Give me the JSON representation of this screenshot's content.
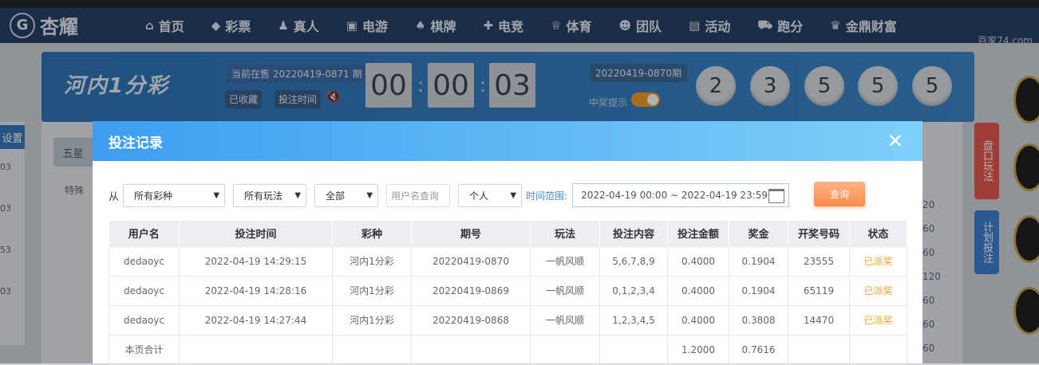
{
  "nav": {
    "logo": "杏耀",
    "items": [
      {
        "icon": "home-icon",
        "glyph": "⌂",
        "label": "首页"
      },
      {
        "icon": "ticket-icon",
        "glyph": "◆",
        "label": "彩票"
      },
      {
        "icon": "person-icon",
        "glyph": "♟",
        "label": "真人"
      },
      {
        "icon": "slot-icon",
        "glyph": "▣",
        "label": "电游"
      },
      {
        "icon": "cards-icon",
        "glyph": "♠",
        "label": "棋牌"
      },
      {
        "icon": "gamepad-icon",
        "glyph": "✚",
        "label": "电竞"
      },
      {
        "icon": "trophy-icon",
        "glyph": "♕",
        "label": "体育"
      },
      {
        "icon": "team-icon",
        "glyph": "☻",
        "label": "团队"
      },
      {
        "icon": "gift-icon",
        "glyph": "▤",
        "label": "活动"
      },
      {
        "icon": "car-icon",
        "glyph": "⛟",
        "label": "跑分"
      },
      {
        "icon": "crown-icon",
        "glyph": "♛",
        "label": "金鼎财富"
      }
    ],
    "watermark": "百家74.com"
  },
  "lottery": {
    "name": "河内1分彩",
    "on_sale": "当前在售 20220419-0871 期",
    "saved": "已收藏",
    "bet_time": "投注时间",
    "countdown": [
      "00",
      "00",
      "03"
    ],
    "prev_period": "20220419-0870期",
    "prize_hint": "中奖提示",
    "balls": [
      "2",
      "3",
      "5",
      "5",
      "5"
    ]
  },
  "background": {
    "settings": "设置",
    "left_values": [
      "03",
      "03",
      "53",
      "03"
    ],
    "five_star": "五星",
    "special": "特殊",
    "right_tabs": [
      "盘口玩法",
      "计划投注"
    ],
    "right_values": [
      "20",
      "60",
      "60",
      "120",
      "60",
      "60",
      "60",
      "60"
    ]
  },
  "modal": {
    "title": "投注记录",
    "close": "✕",
    "from_label": "从",
    "lottery_select": "所有彩种",
    "play_select": "所有玩法",
    "all_select": "全部",
    "username_placeholder": "用户名查询",
    "scope_select": "个人",
    "time_label": "时间范围:",
    "date_range": "2022-04-19 00:00 ~ 2022-04-19 23:59",
    "query": "查询",
    "columns": [
      "用户名",
      "投注时间",
      "彩种",
      "期号",
      "玩法",
      "投注内容",
      "投注金额",
      "奖金",
      "开奖号码",
      "状态"
    ],
    "rows": [
      [
        "dedaoyc",
        "2022-04-19 14:29:15",
        "河内1分彩",
        "20220419-0870",
        "一帆风顺",
        "5,6,7,8,9",
        "0.4000",
        "0.1904",
        "23555",
        "已派奖"
      ],
      [
        "dedaoyc",
        "2022-04-19 14:28:16",
        "河内1分彩",
        "20220419-0869",
        "一帆风顺",
        "0,1,2,3,4",
        "0.4000",
        "0.1904",
        "65119",
        "已派奖"
      ],
      [
        "dedaoyc",
        "2022-04-19 14:27:44",
        "河内1分彩",
        "20220419-0868",
        "一帆风顺",
        "1,2,3,4,5",
        "0.4000",
        "0.3808",
        "14470",
        "已派奖"
      ]
    ],
    "subtotal": {
      "label": "本页合计",
      "amount": "1.2000",
      "prize": "0.7616"
    }
  }
}
